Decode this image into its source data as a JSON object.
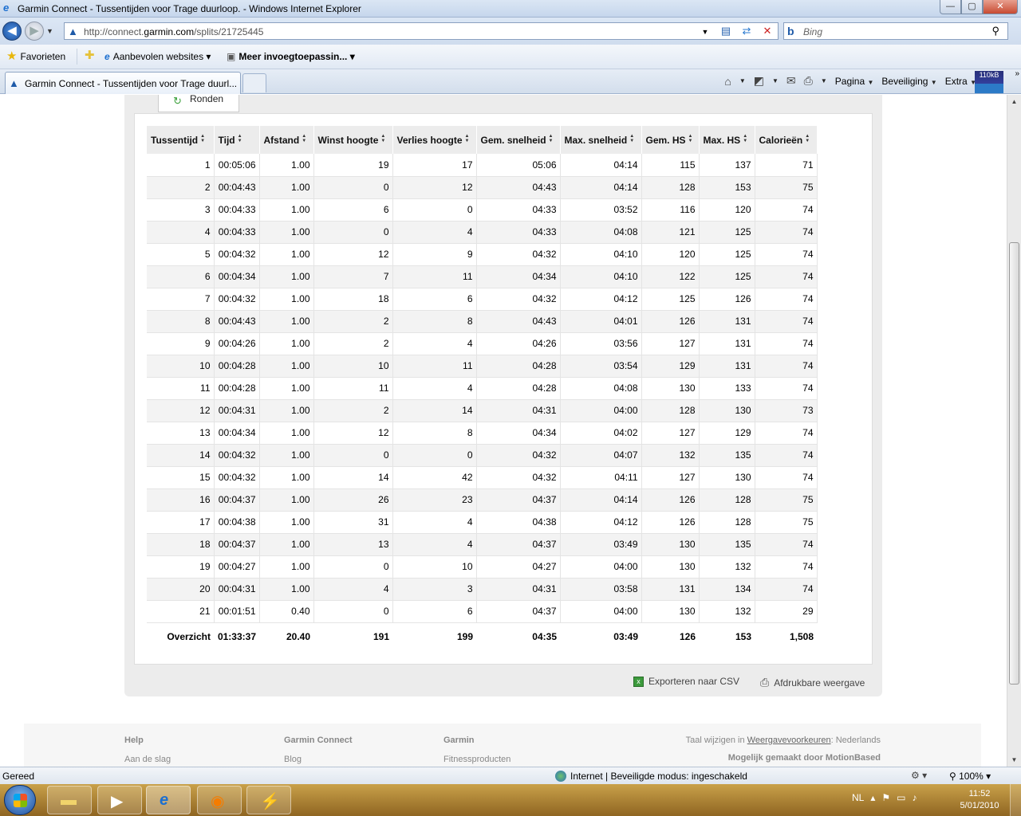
{
  "window": {
    "title": "Garmin Connect - Tussentijden voor Trage duurloop. - Windows Internet Explorer",
    "buttons": {
      "minimize": "—",
      "maximize": "▢",
      "close": "✕"
    }
  },
  "address_bar": {
    "url_prefix": "http://connect.",
    "url_domain": "garmin.com",
    "url_path": "/splits/21725445",
    "search_placeholder": "Bing"
  },
  "favorites_bar": {
    "favorites_label": "Favorieten",
    "suggested_sites": "Aanbevolen websites ▾",
    "addons": "Meer invoegtoepassin... ▾"
  },
  "tab": {
    "label": "Garmin Connect - Tussentijden voor Trage duurl..."
  },
  "command_bar": {
    "page": "Pagina",
    "safety": "Beveiliging",
    "tools": "Extra",
    "cpu_label": "110kB"
  },
  "page": {
    "laps_tab": "Ronden",
    "table": {
      "headers": [
        "Tussentijd",
        "Tijd",
        "Afstand",
        "Winst hoogte",
        "Verlies hoogte",
        "Gem. snelheid",
        "Max. snelheid",
        "Gem. HS",
        "Max. HS",
        "Calorieën"
      ],
      "rows": [
        [
          "1",
          "00:05:06",
          "1.00",
          "19",
          "17",
          "05:06",
          "04:14",
          "115",
          "137",
          "71"
        ],
        [
          "2",
          "00:04:43",
          "1.00",
          "0",
          "12",
          "04:43",
          "04:14",
          "128",
          "153",
          "75"
        ],
        [
          "3",
          "00:04:33",
          "1.00",
          "6",
          "0",
          "04:33",
          "03:52",
          "116",
          "120",
          "74"
        ],
        [
          "4",
          "00:04:33",
          "1.00",
          "0",
          "4",
          "04:33",
          "04:08",
          "121",
          "125",
          "74"
        ],
        [
          "5",
          "00:04:32",
          "1.00",
          "12",
          "9",
          "04:32",
          "04:10",
          "120",
          "125",
          "74"
        ],
        [
          "6",
          "00:04:34",
          "1.00",
          "7",
          "11",
          "04:34",
          "04:10",
          "122",
          "125",
          "74"
        ],
        [
          "7",
          "00:04:32",
          "1.00",
          "18",
          "6",
          "04:32",
          "04:12",
          "125",
          "126",
          "74"
        ],
        [
          "8",
          "00:04:43",
          "1.00",
          "2",
          "8",
          "04:43",
          "04:01",
          "126",
          "131",
          "74"
        ],
        [
          "9",
          "00:04:26",
          "1.00",
          "2",
          "4",
          "04:26",
          "03:56",
          "127",
          "131",
          "74"
        ],
        [
          "10",
          "00:04:28",
          "1.00",
          "10",
          "11",
          "04:28",
          "03:54",
          "129",
          "131",
          "74"
        ],
        [
          "11",
          "00:04:28",
          "1.00",
          "11",
          "4",
          "04:28",
          "04:08",
          "130",
          "133",
          "74"
        ],
        [
          "12",
          "00:04:31",
          "1.00",
          "2",
          "14",
          "04:31",
          "04:00",
          "128",
          "130",
          "73"
        ],
        [
          "13",
          "00:04:34",
          "1.00",
          "12",
          "8",
          "04:34",
          "04:02",
          "127",
          "129",
          "74"
        ],
        [
          "14",
          "00:04:32",
          "1.00",
          "0",
          "0",
          "04:32",
          "04:07",
          "132",
          "135",
          "74"
        ],
        [
          "15",
          "00:04:32",
          "1.00",
          "14",
          "42",
          "04:32",
          "04:11",
          "127",
          "130",
          "74"
        ],
        [
          "16",
          "00:04:37",
          "1.00",
          "26",
          "23",
          "04:37",
          "04:14",
          "126",
          "128",
          "75"
        ],
        [
          "17",
          "00:04:38",
          "1.00",
          "31",
          "4",
          "04:38",
          "04:12",
          "126",
          "128",
          "75"
        ],
        [
          "18",
          "00:04:37",
          "1.00",
          "13",
          "4",
          "04:37",
          "03:49",
          "130",
          "135",
          "74"
        ],
        [
          "19",
          "00:04:27",
          "1.00",
          "0",
          "10",
          "04:27",
          "04:00",
          "130",
          "132",
          "74"
        ],
        [
          "20",
          "00:04:31",
          "1.00",
          "4",
          "3",
          "04:31",
          "03:58",
          "131",
          "134",
          "74"
        ],
        [
          "21",
          "00:01:51",
          "0.40",
          "0",
          "6",
          "04:37",
          "04:00",
          "130",
          "132",
          "29"
        ]
      ],
      "summary": [
        "Overzicht",
        "01:33:37",
        "20.40",
        "191",
        "199",
        "04:35",
        "03:49",
        "126",
        "153",
        "1,508"
      ]
    },
    "export_csv": "Exporteren naar CSV",
    "print_view": "Afdrukbare weergave"
  },
  "footer": {
    "col1_heading": "Help",
    "col1_link": "Aan de slag",
    "col2_heading": "Garmin Connect",
    "col2_link": "Blog",
    "col3_heading": "Garmin",
    "col3_link": "Fitnessproducten",
    "language_prefix": "Taal wijzigen in",
    "language_link": "Weergavevoorkeuren",
    "language_value": ": Nederlands",
    "powered_by": "Mogelijk gemaakt door MotionBased"
  },
  "status_bar": {
    "status": "Gereed",
    "zone": "Internet | Beveiligde modus: ingeschakeld",
    "zoom": "100%"
  },
  "taskbar": {
    "language": "NL",
    "time": "11:52",
    "date": "5/01/2010"
  }
}
